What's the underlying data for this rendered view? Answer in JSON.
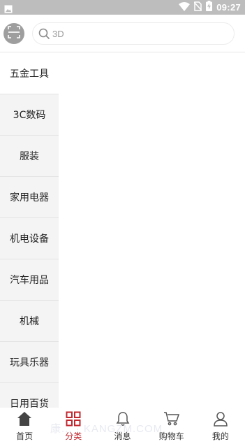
{
  "status_bar": {
    "time": "09:27",
    "left_icon": "image-icon",
    "right_icons": [
      "wifi-icon",
      "no-sim-icon",
      "battery-charging-icon"
    ]
  },
  "header": {
    "scan_icon": "scan-icon",
    "search": {
      "icon": "search-icon",
      "value": "3D"
    }
  },
  "sidebar": {
    "items": [
      {
        "label": "五金工具",
        "active": true
      },
      {
        "label": "3C数码"
      },
      {
        "label": "服装"
      },
      {
        "label": "家用电器"
      },
      {
        "label": "机电设备"
      },
      {
        "label": "汽车用品"
      },
      {
        "label": "机械"
      },
      {
        "label": "玩具乐器"
      },
      {
        "label": "日用百货"
      }
    ]
  },
  "bottom_nav": {
    "items": [
      {
        "label": "首页",
        "icon": "home-icon"
      },
      {
        "label": "分类",
        "icon": "category-grid-icon",
        "active": true
      },
      {
        "label": "消息",
        "icon": "bell-icon"
      },
      {
        "label": "购物车",
        "icon": "cart-icon"
      },
      {
        "label": "我的",
        "icon": "user-icon"
      }
    ]
  },
  "watermark": "康... · KANGZM.COM",
  "colors": {
    "status_bar": "#bdbdbd",
    "accent": "#c0272d",
    "sidebar_bg": "#f4f4f4"
  }
}
